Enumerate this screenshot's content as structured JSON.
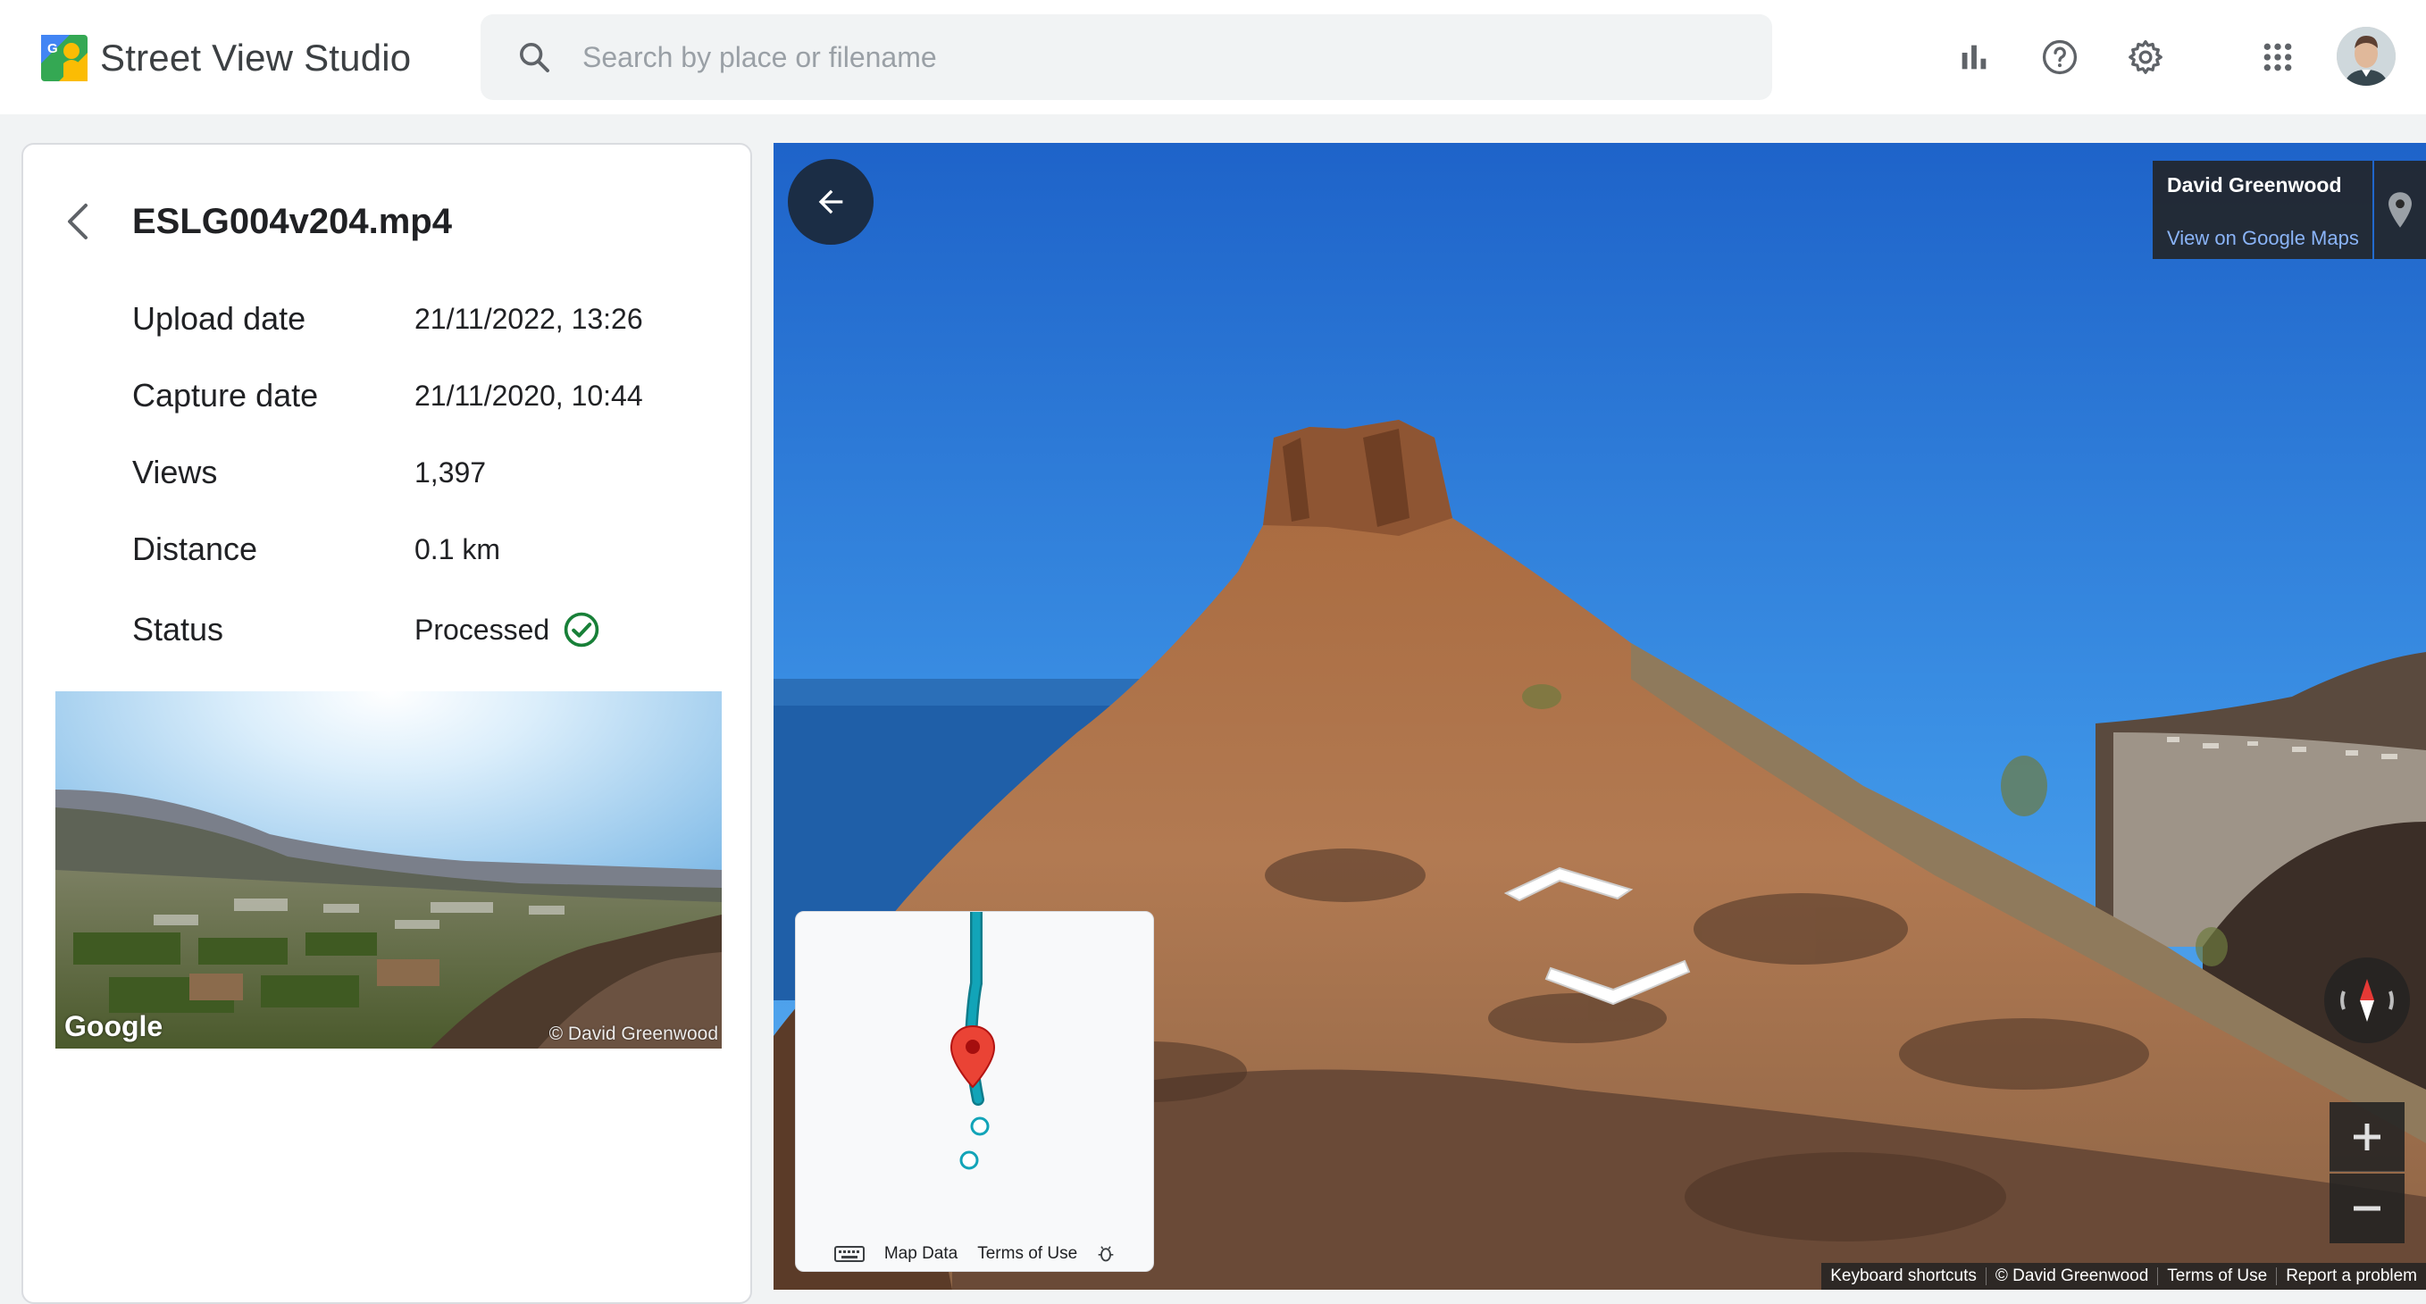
{
  "app": {
    "title": "Street View Studio"
  },
  "search": {
    "placeholder": "Search by place or filename"
  },
  "header": {
    "icons": [
      "bar-chart-icon",
      "help-icon",
      "settings-icon",
      "apps-grid-icon"
    ]
  },
  "file": {
    "name": "ESLG004v204.mp4",
    "details": [
      {
        "label": "Upload date",
        "value": "21/11/2022, 13:26"
      },
      {
        "label": "Capture date",
        "value": "21/11/2020, 10:44"
      },
      {
        "label": "Views",
        "value": "1,397"
      },
      {
        "label": "Distance",
        "value": "0.1 km"
      },
      {
        "label": "Status",
        "value": "Processed"
      }
    ],
    "status_color": "#188038"
  },
  "thumbnail": {
    "watermark": "Google",
    "copyright": "© David Greenwood"
  },
  "viewer": {
    "owner_name": "David Greenwood",
    "owner_link": "View on Google Maps",
    "minimap": {
      "map_data": "Map Data",
      "terms": "Terms of Use"
    },
    "footer": {
      "shortcuts": "Keyboard shortcuts",
      "copyright": "© David Greenwood",
      "terms": "Terms of Use",
      "report": "Report a problem"
    },
    "route_color": "#12a4b8",
    "pin_color": "#ea4335"
  }
}
